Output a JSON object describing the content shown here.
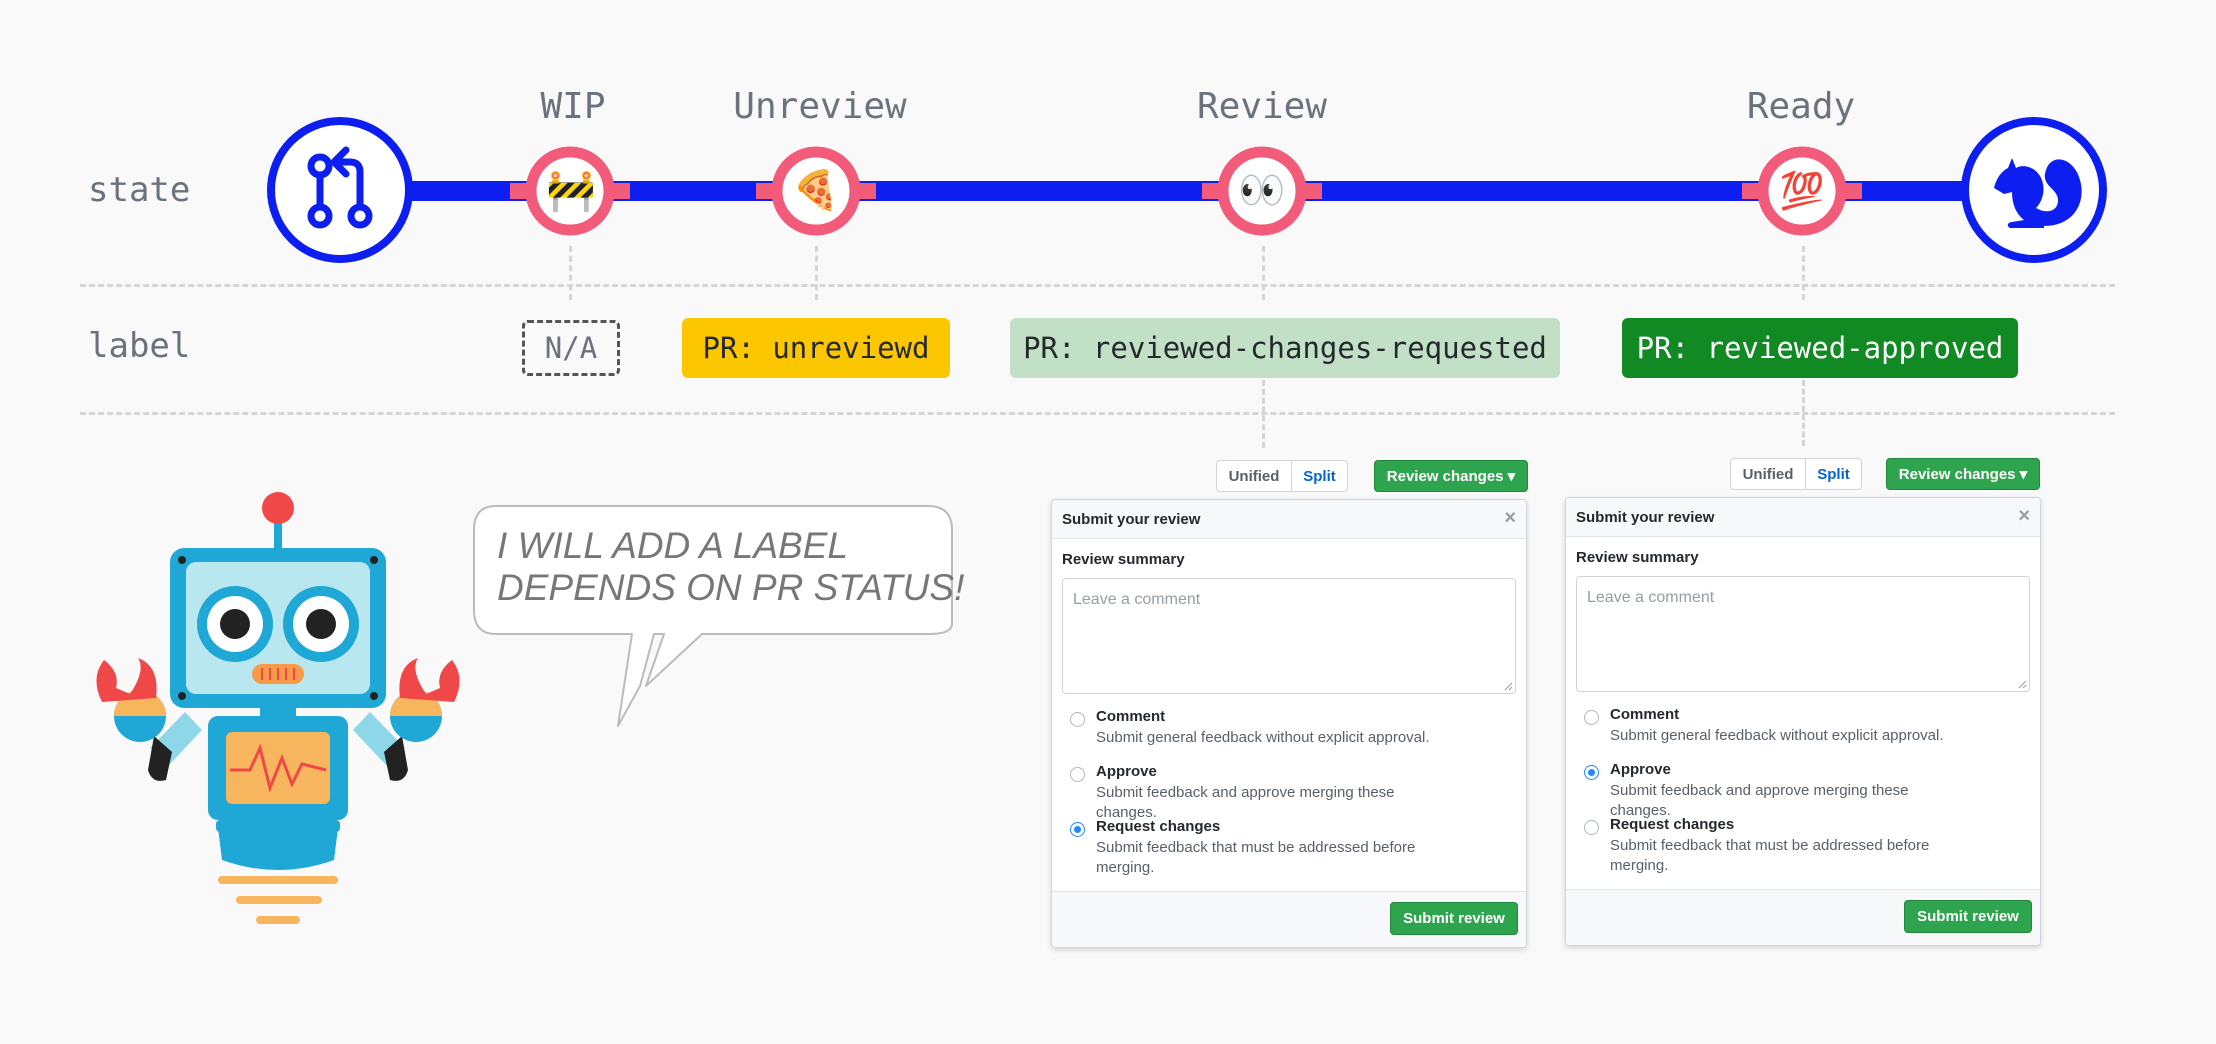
{
  "colors": {
    "track": "#0d1ff0",
    "stage_ring": "#f25b7a",
    "label_unreviewed": "#fcc700",
    "label_changes": "#c2e0c6",
    "label_approved": "#128a23",
    "button_green": "#2ea44f"
  },
  "row_labels": {
    "state": "state",
    "label": "label"
  },
  "start_icon": "pull-request-icon",
  "end_icon": "squirrel-icon",
  "stages": [
    {
      "title": "WIP",
      "emoji": "🚧",
      "label": "N/A"
    },
    {
      "title": "Unreview",
      "emoji": "🍕",
      "label": "PR: unreviewd"
    },
    {
      "title": "Review",
      "emoji": "👀",
      "label": "PR: reviewed-changes-requested"
    },
    {
      "title": "Ready",
      "emoji": "💯",
      "label": "PR: reviewed-approved"
    }
  ],
  "speech": {
    "line1": "I WILL ADD A LABEL",
    "line2": "DEPENDS ON PR STATUS!"
  },
  "review_panels": [
    {
      "unified": "Unified",
      "split": "Split",
      "review_changes": "Review changes ▾",
      "header": "Submit your review",
      "close": "×",
      "summary_label": "Review summary",
      "placeholder": "Leave a comment",
      "options": [
        {
          "title": "Comment",
          "desc": "Submit general feedback without explicit approval.",
          "selected": false
        },
        {
          "title": "Approve",
          "desc": "Submit feedback and approve merging these changes.",
          "selected": false
        },
        {
          "title": "Request changes",
          "desc": "Submit feedback that must be addressed before merging.",
          "selected": true
        }
      ],
      "submit": "Submit review"
    },
    {
      "unified": "Unified",
      "split": "Split",
      "review_changes": "Review changes ▾",
      "header": "Submit your review",
      "close": "×",
      "summary_label": "Review summary",
      "placeholder": "Leave a comment",
      "options": [
        {
          "title": "Comment",
          "desc": "Submit general feedback without explicit approval.",
          "selected": false
        },
        {
          "title": "Approve",
          "desc": "Submit feedback and approve merging these changes.",
          "selected": true
        },
        {
          "title": "Request changes",
          "desc": "Submit feedback that must be addressed before merging.",
          "selected": false
        }
      ],
      "submit": "Submit review"
    }
  ]
}
